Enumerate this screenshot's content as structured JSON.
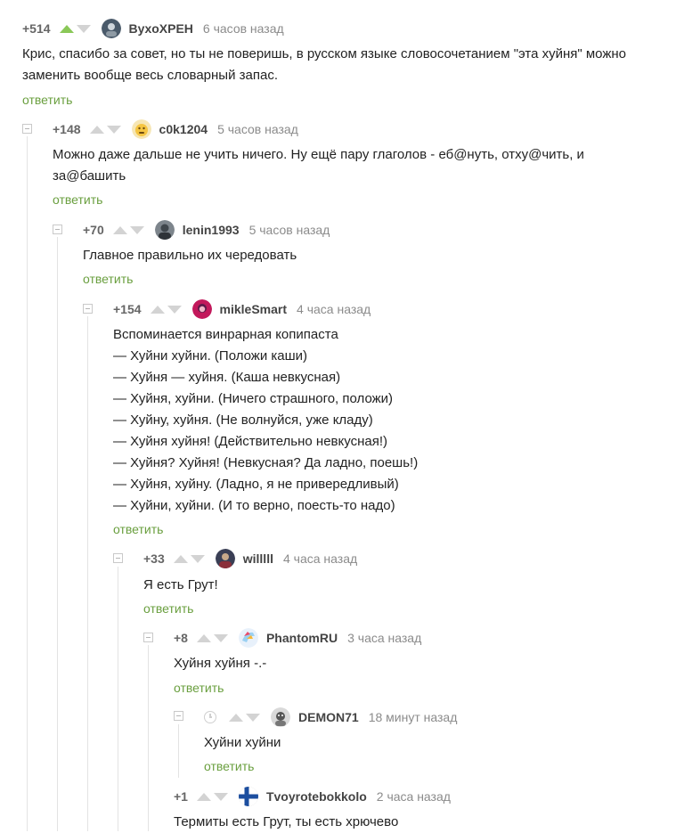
{
  "reply_label": "ответить",
  "comments": [
    {
      "rating": "+514",
      "user": "BуxoXPEH",
      "time": "6 часов назад",
      "text": "Крис, спасибо за совет, но ты не поверишь, в русском языке словосочетанием \"эта хуйня\" можно\nзаменить вообще весь словарный запас."
    },
    {
      "rating": "+148",
      "user": "c0k1204",
      "time": "5 часов назад",
      "text": "Можно даже дальше не учить ничего. Ну ещё пару глаголов - еб@нуть, отху@чить, и\nза@башить"
    },
    {
      "rating": "+70",
      "user": "lenin1993",
      "time": "5 часов назад",
      "text": "Главное правильно их чередовать"
    },
    {
      "rating": "+154",
      "user": "mikleSmart",
      "time": "4 часа назад",
      "text": "Вспоминается винрарная копипаста\n— Хуйни хуйни. (Положи каши)\n— Хуйня — хуйня. (Каша невкусная)\n— Хуйня, хуйни. (Ничего страшного, положи)\n— Хуйну, хуйня. (Не волнуйся, уже кладу)\n— Хуйня хуйня! (Действительно невкусная!)\n— Хуйня? Хуйня! (Невкусная? Да ладно, поешь!)\n— Хуйня, хуйну. (Ладно, я не привередливый)\n— Хуйни, хуйни. (И то верно, поесть-то надо)"
    },
    {
      "rating": "+33",
      "user": "willlll",
      "time": "4 часа назад",
      "text": "Я есть Грут!"
    },
    {
      "rating": "+8",
      "user": "PhantomRU",
      "time": "3 часа назад",
      "text": "Хуйня хуйня -.-"
    },
    {
      "rating": "",
      "user": "DEMON71",
      "time": "18 минут назад",
      "text": "Хуйни хуйни"
    },
    {
      "rating": "+1",
      "user": "Tvoyrotebokkolo",
      "time": "2 часа назад",
      "text": "Термиты есть Грут, ты есть хрючево"
    }
  ],
  "colors": {
    "accent": "#6a9f3f",
    "upvote_active": "#8ac858"
  }
}
